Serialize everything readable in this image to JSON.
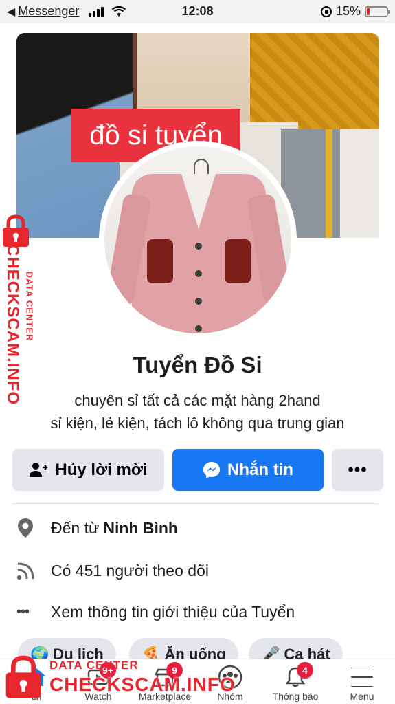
{
  "status_bar": {
    "back_app": "Messenger",
    "time": "12:08",
    "battery": "15%",
    "battery_level": 0.15
  },
  "cover": {
    "tag_text": "đồ si tuyển"
  },
  "profile": {
    "name": "Tuyển Đồ Si",
    "bio_line1": "chuyên sỉ tất cả các mặt hàng 2hand",
    "bio_line2": "sỉ kiện, lẻ kiện, tách lô không qua trung gian"
  },
  "actions": {
    "cancel_label": "Hủy lời mời",
    "message_label": "Nhắn tin",
    "more_label": "•••"
  },
  "info": {
    "location_prefix": "Đến từ",
    "location": "Ninh Bình",
    "followers": "Có 451 người theo dõi",
    "about": "Xem thông tin giới thiệu của Tuyển"
  },
  "chips": [
    {
      "label": "Du lịch"
    },
    {
      "label": "Ăn uống"
    },
    {
      "label": "Ca hát"
    }
  ],
  "bottom_nav": {
    "items": [
      {
        "label": "tin",
        "icon": "home-icon"
      },
      {
        "label": "Watch",
        "icon": "watch-icon",
        "badge": "9+"
      },
      {
        "label": "Marketplace",
        "icon": "marketplace-icon",
        "badge": "9"
      },
      {
        "label": "Nhóm",
        "icon": "groups-icon"
      },
      {
        "label": "Thông báo",
        "icon": "bell-icon",
        "badge": "4"
      },
      {
        "label": "Menu",
        "icon": "menu-icon"
      }
    ]
  },
  "watermark": {
    "small": "DATA CENTER",
    "big": "CHECKSCAM.INFO"
  },
  "colors": {
    "accent": "#1877f2",
    "watermark": "#e8262e",
    "badge": "#e41e3f"
  }
}
